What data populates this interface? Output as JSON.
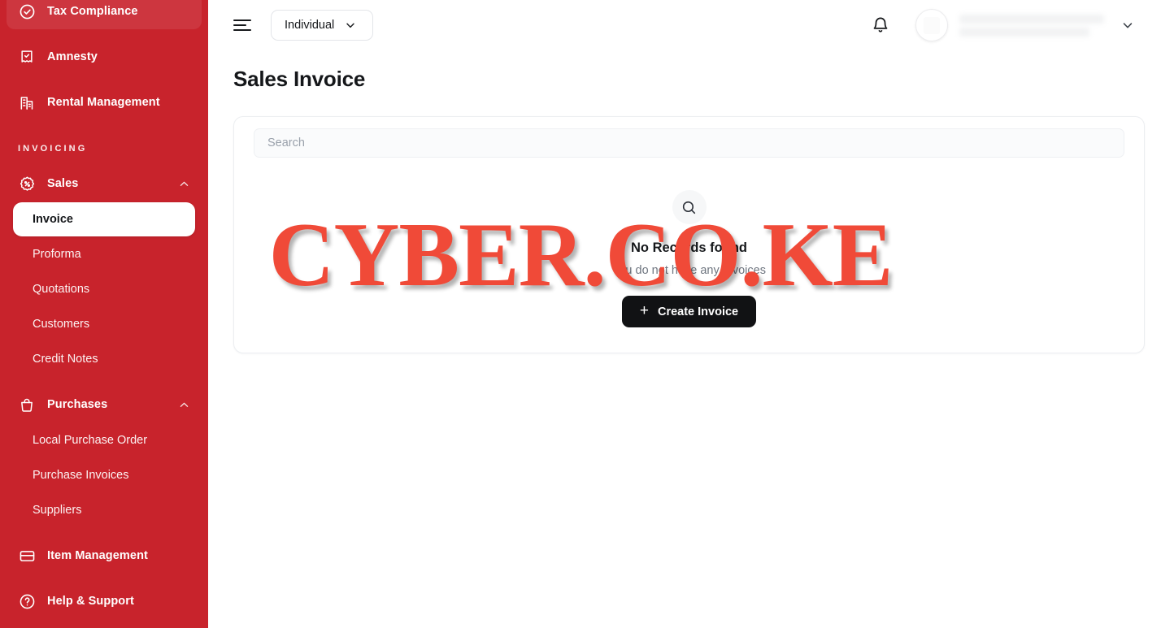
{
  "colors": {
    "sidebar_bg": "#c8232c",
    "active_item_bg": "#ffffff",
    "button_dark": "#111214",
    "watermark_red": "#f04a38",
    "page_bg": "#ffffff"
  },
  "sidebar": {
    "items": [
      {
        "label": "Tax Compliance",
        "icon": "check-circle-icon",
        "type": "nav",
        "state": "hovered"
      },
      {
        "label": "Amnesty",
        "icon": "receipt-check-icon",
        "type": "nav",
        "state": "normal"
      },
      {
        "label": "Rental Management",
        "icon": "building-icon",
        "type": "nav",
        "state": "normal"
      }
    ],
    "section_label": "INVOICING",
    "groups": [
      {
        "label": "Sales",
        "icon": "percent-badge-icon",
        "chevron": "chevron-up-icon",
        "expanded": true,
        "children": [
          {
            "label": "Invoice",
            "active": true
          },
          {
            "label": "Proforma",
            "active": false
          },
          {
            "label": "Quotations",
            "active": false
          },
          {
            "label": "Customers",
            "active": false
          },
          {
            "label": "Credit Notes",
            "active": false
          }
        ]
      },
      {
        "label": "Purchases",
        "icon": "bag-icon",
        "chevron": "chevron-up-icon",
        "expanded": true,
        "children": [
          {
            "label": "Local Purchase Order",
            "active": false
          },
          {
            "label": "Purchase Invoices",
            "active": false
          },
          {
            "label": "Suppliers",
            "active": false
          }
        ]
      }
    ],
    "footer_items": [
      {
        "label": "Item Management",
        "icon": "card-icon"
      },
      {
        "label": "Help & Support",
        "icon": "question-circle-icon"
      }
    ]
  },
  "topbar": {
    "menu_icon": "hamburger-icon",
    "entity_selector": {
      "value": "Individual",
      "chevron": "chevron-down-icon"
    },
    "notifications_icon": "bell-icon",
    "user_chevron": "chevron-down-icon",
    "user_name_redacted": true
  },
  "page": {
    "title": "Sales Invoice"
  },
  "search": {
    "placeholder": "Search",
    "value": ""
  },
  "empty_state": {
    "icon": "search-icon",
    "title": "No Records found",
    "subtitle": "You do not have any Invoices",
    "cta_label": "Create Invoice",
    "cta_icon": "plus-icon"
  },
  "watermark": {
    "text": "CYBER.CO.KE"
  }
}
